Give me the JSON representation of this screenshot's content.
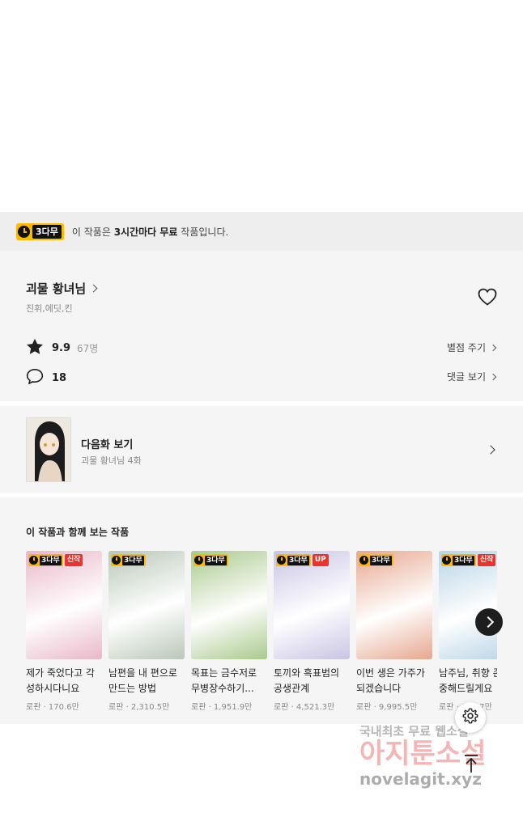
{
  "free_banner": {
    "badge_label": "3다무",
    "prefix": "이 작품은 ",
    "bold": "3시간마다 무료",
    "suffix": " 작품입니다."
  },
  "work": {
    "title": "괴물 황녀님",
    "authors": "진휘,에딧,킨",
    "rating": "9.9",
    "rating_count": "67명",
    "rate_link": "별점 주기",
    "comment_count": "18",
    "comment_link": "댓글 보기"
  },
  "next_episode": {
    "label": "다음화 보기",
    "subtitle": "괴물 황녀님 4화"
  },
  "recommendations": {
    "heading": "이 작품과 함께 보는 작품",
    "items": [
      {
        "title": "제가 죽었다고 각\n성하시다니요",
        "meta": "로판 · 170.6만",
        "tag": "신작",
        "cover": "#e9b7c9"
      },
      {
        "title": "남편을 내 편으로\n만드는 방법",
        "meta": "로판 · 2,310.5만",
        "tag": "",
        "cover": "#b9c7b8"
      },
      {
        "title": "목표는 금수저로\n무병장수하기...",
        "meta": "로판 · 1,951.9만",
        "tag": "",
        "cover": "#a9c98c"
      },
      {
        "title": "토끼와 흑표범의\n공생관계",
        "meta": "로판 · 4,521.3만",
        "tag": "UP",
        "cover": "#c9c4e4"
      },
      {
        "title": "이번 생은 가주가\n되겠습니다",
        "meta": "로판 · 9,995.5만",
        "tag": "",
        "cover": "#e7a78f"
      },
      {
        "title": "남주님, 취향 존\n중해드릴게요",
        "meta": "로판 · 996.7만",
        "tag": "신작",
        "cover": "#b7d4e6"
      }
    ]
  },
  "watermark": {
    "line1": "국내최초 무료 웹소설",
    "line2": "아지툰소설",
    "line3": "novelagit.xyz"
  },
  "icons": {
    "heart": "heart-icon",
    "star": "star-icon",
    "comment": "comment-icon",
    "settings": "gear-icon",
    "to_top": "arrow-up-icon"
  }
}
